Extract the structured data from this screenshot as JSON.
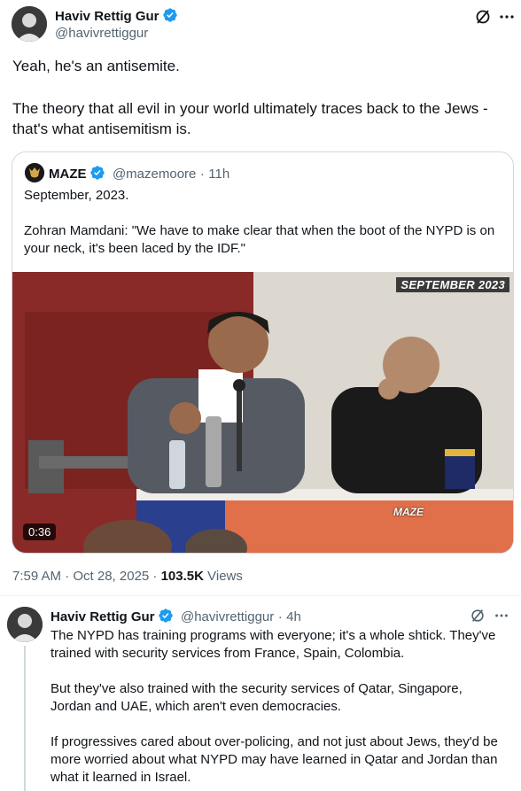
{
  "main_tweet": {
    "author_name": "Haviv Rettig Gur",
    "author_handle": "@havivrettiggur",
    "text_line1": "Yeah, he's an antisemite.",
    "text_line2": "The theory that all evil in your world ultimately traces back to the Jews - that's what antisemitism is.",
    "timestamp": "7:59 AM · Oct 28, 2025 ·",
    "views_count": "103.5K",
    "views_label": "Views"
  },
  "quoted_tweet": {
    "author_name": "MAZE",
    "author_handle": "@mazemoore",
    "separator": "·",
    "time": "11h",
    "text_line1": "September, 2023.",
    "text_line2": "Zohran Mamdani: \"We have to make clear that when the boot of the NYPD is on your neck, it's been laced by the IDF.\"",
    "video": {
      "banner": "SEPTEMBER 2023",
      "duration": "0:36",
      "watermark": "MAZE"
    }
  },
  "reply_tweet": {
    "author_name": "Haviv Rettig Gur",
    "author_handle": "@havivrettiggur",
    "separator": "·",
    "time": "4h",
    "para1": "The NYPD has training programs with everyone; it's a whole shtick. They've trained with security services from France, Spain, Colombia.",
    "para2": "But they've also trained with the security services of Qatar, Singapore, Jordan and UAE, which aren't even democracies.",
    "para3": "If progressives cared about over-policing, and not just about Jews, they'd be more worried about what NYPD may have learned in Qatar and Jordan than what it learned in Israel."
  },
  "icons": {
    "verified": "verified-badge-icon",
    "grok": "grok-icon",
    "more": "more-icon"
  },
  "colors": {
    "verified_blue": "#1d9bf0",
    "secondary_text": "#536471",
    "border": "#cfd9de",
    "thread_line": "#cfd9de"
  }
}
